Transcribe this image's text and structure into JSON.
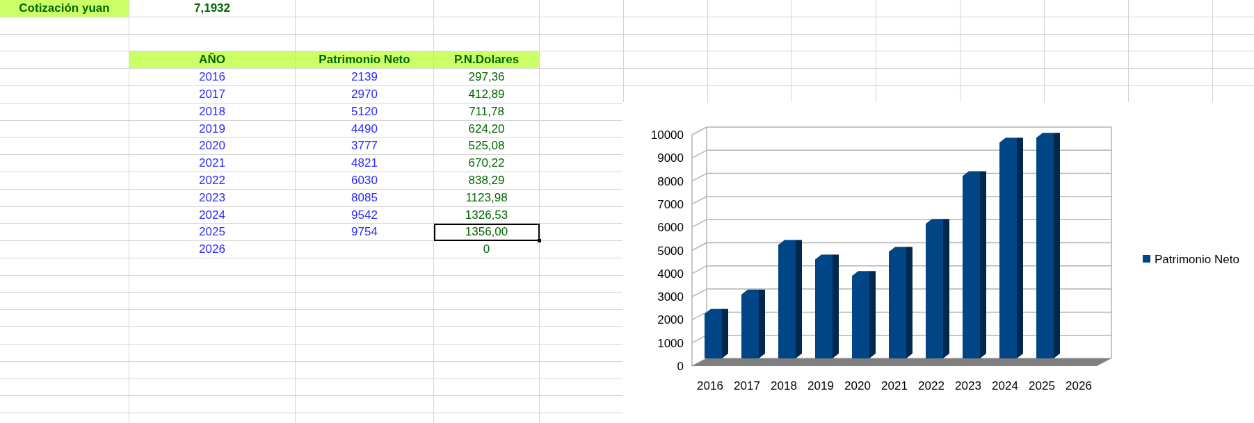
{
  "sheet": {
    "rate": {
      "label": "Cotización yuan",
      "value": "7,1932"
    },
    "table": {
      "columns": [
        "AÑO",
        "Patrimonio Neto",
        "P.N.Dolares"
      ],
      "rows": [
        {
          "cells": [
            "2016",
            "2139",
            "297,36"
          ],
          "selected": false
        },
        {
          "cells": [
            "2017",
            "2970",
            "412,89"
          ],
          "selected": false
        },
        {
          "cells": [
            "2018",
            "5120",
            "711,78"
          ],
          "selected": false
        },
        {
          "cells": [
            "2019",
            "4490",
            "624,20"
          ],
          "selected": false
        },
        {
          "cells": [
            "2020",
            "3777",
            "525,08"
          ],
          "selected": false
        },
        {
          "cells": [
            "2021",
            "4821",
            "670,22"
          ],
          "selected": false
        },
        {
          "cells": [
            "2022",
            "6030",
            "838,29"
          ],
          "selected": false
        },
        {
          "cells": [
            "2023",
            "8085",
            "1123,98"
          ],
          "selected": false
        },
        {
          "cells": [
            "2024",
            "9542",
            "1326,53"
          ],
          "selected": false
        },
        {
          "cells": [
            "2025",
            "9754",
            "1356,00"
          ],
          "selected": true
        },
        {
          "cells": [
            "2026",
            null,
            "0"
          ],
          "selected": false
        }
      ]
    }
  },
  "chart": {
    "chart_data": {
      "type": "bar",
      "categories": [
        "2016",
        "2017",
        "2018",
        "2019",
        "2020",
        "2021",
        "2022",
        "2023",
        "2024",
        "2025",
        "2026"
      ],
      "series": [
        {
          "name": "Patrimonio Neto",
          "color": "#004586",
          "values": [
            2140,
            2970,
            5120,
            4490,
            3780,
            4820,
            6030,
            8090,
            9540,
            9750,
            null
          ]
        }
      ],
      "grid": true,
      "ylim": [
        0,
        10000
      ],
      "yticks": [
        0,
        1000,
        2000,
        3000,
        4000,
        5000,
        6000,
        7000,
        8000,
        9000,
        10000
      ]
    }
  }
}
